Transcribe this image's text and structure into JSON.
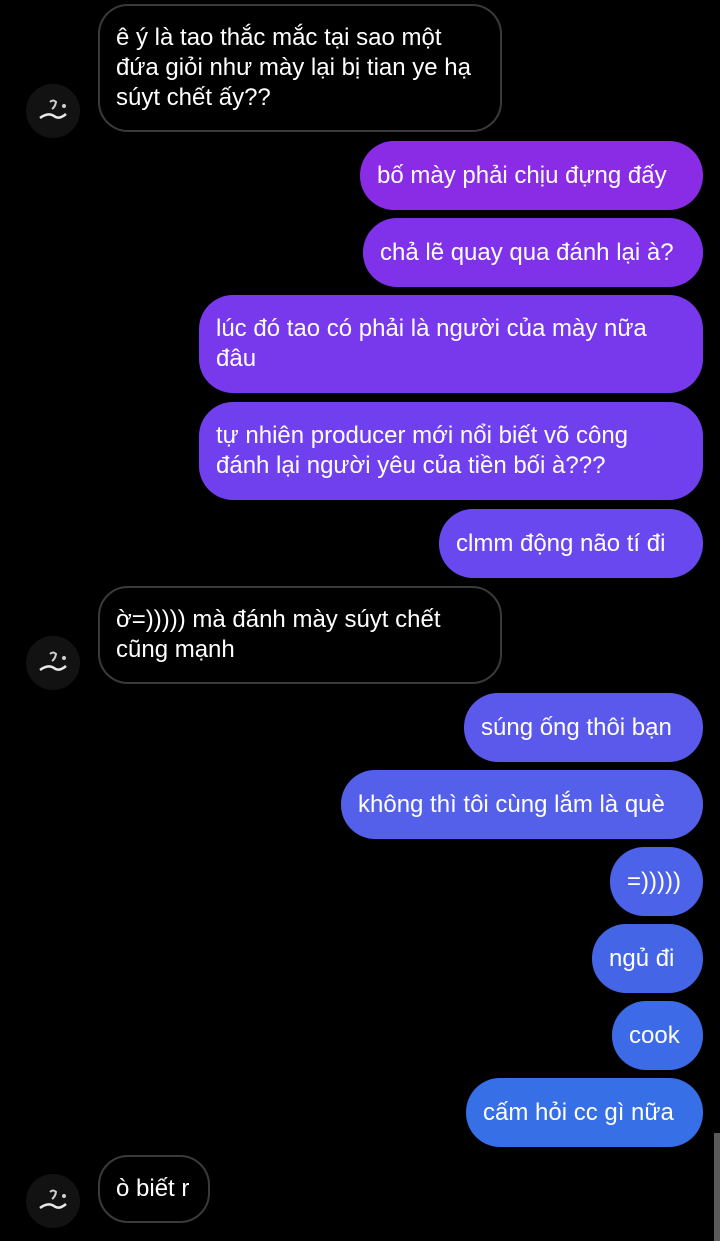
{
  "messages": [
    {
      "from": "them",
      "text": "ê ý là tao thắc mắc tại sao một đứa giỏi như mày lại bị tian ye hạ súyt chết ấy??"
    },
    {
      "from": "me",
      "text": "bố mày phải chịu đựng đấy"
    },
    {
      "from": "me",
      "text": "chả lẽ quay qua đánh lại à?"
    },
    {
      "from": "me",
      "text": "lúc đó tao có phải là người của mày nữa đâu"
    },
    {
      "from": "me",
      "text": "tự nhiên producer mới nổi biết võ công đánh lại người yêu của tiền bối à???"
    },
    {
      "from": "me",
      "text": "clmm động não tí đi"
    },
    {
      "from": "them",
      "text": "ờ=))))) mà đánh mày súyt chết cũng mạnh"
    },
    {
      "from": "me",
      "text": "súng ống thôi bạn"
    },
    {
      "from": "me",
      "text": "không thì tôi cùng lắm là què"
    },
    {
      "from": "me",
      "text": "=)))))"
    },
    {
      "from": "me",
      "text": "ngủ đi"
    },
    {
      "from": "me",
      "text": "cook"
    },
    {
      "from": "me",
      "text": "cấm hỏi cc gì nữa"
    },
    {
      "from": "them",
      "text": "ò biết r"
    }
  ],
  "colors": {
    "background": "#000000",
    "incoming_border": "#3a3a3a",
    "outgoing_gradient": [
      "#8a2be6",
      "#7a38ee",
      "#6a4cf0",
      "#5a58ec",
      "#4f5ee8",
      "#3e6ae6",
      "#3570e6"
    ]
  },
  "icons": {
    "avatar": "user-avatar-icon"
  }
}
